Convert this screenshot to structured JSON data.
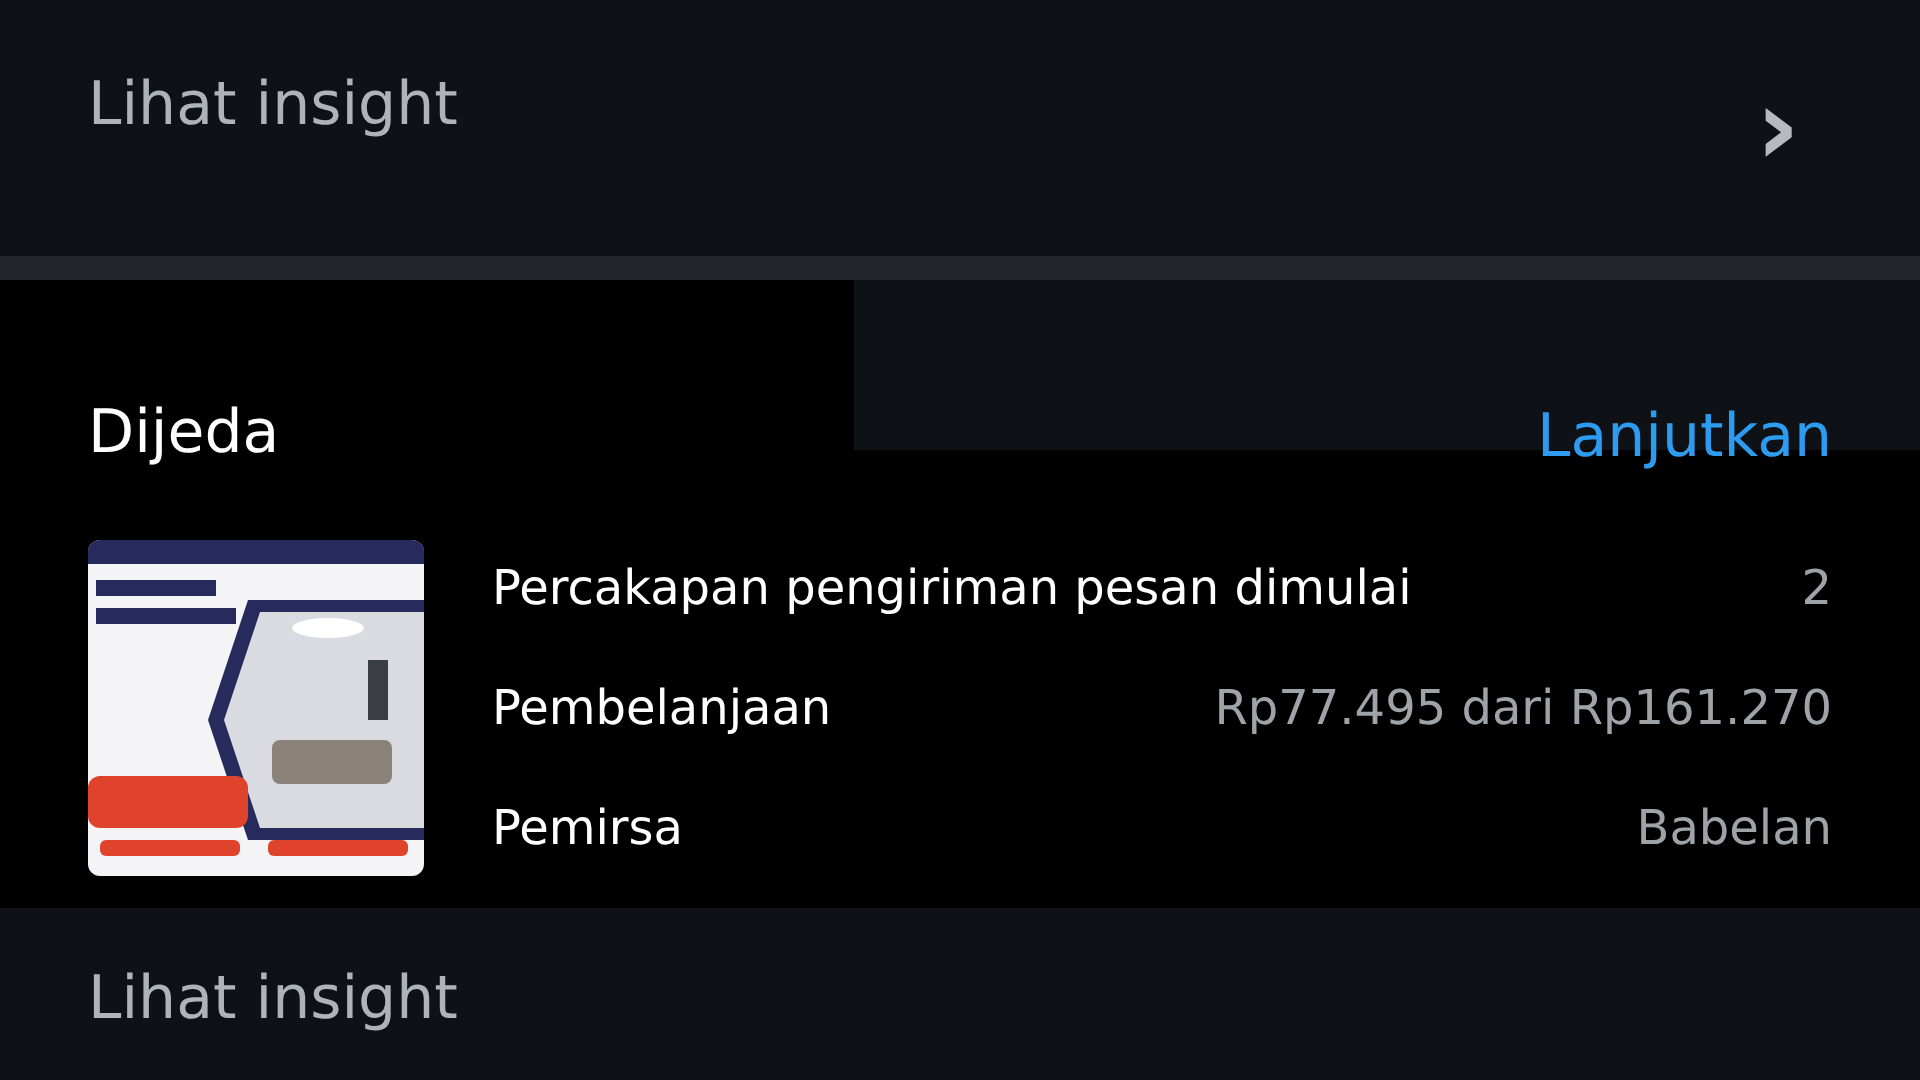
{
  "insight_top": {
    "label": "Lihat insight",
    "chevron": "›"
  },
  "paused_card": {
    "status": "Dijeda",
    "action": "Lanjutkan",
    "metrics": [
      {
        "label": "Percakapan pengiriman pesan dimulai",
        "value": "2"
      },
      {
        "label": "Pembelanjaan",
        "value": "Rp77.495 dari Rp161.270"
      },
      {
        "label": "Pemirsa",
        "value": "Babelan"
      }
    ]
  },
  "insight_bottom": {
    "label": "Lihat insight"
  }
}
